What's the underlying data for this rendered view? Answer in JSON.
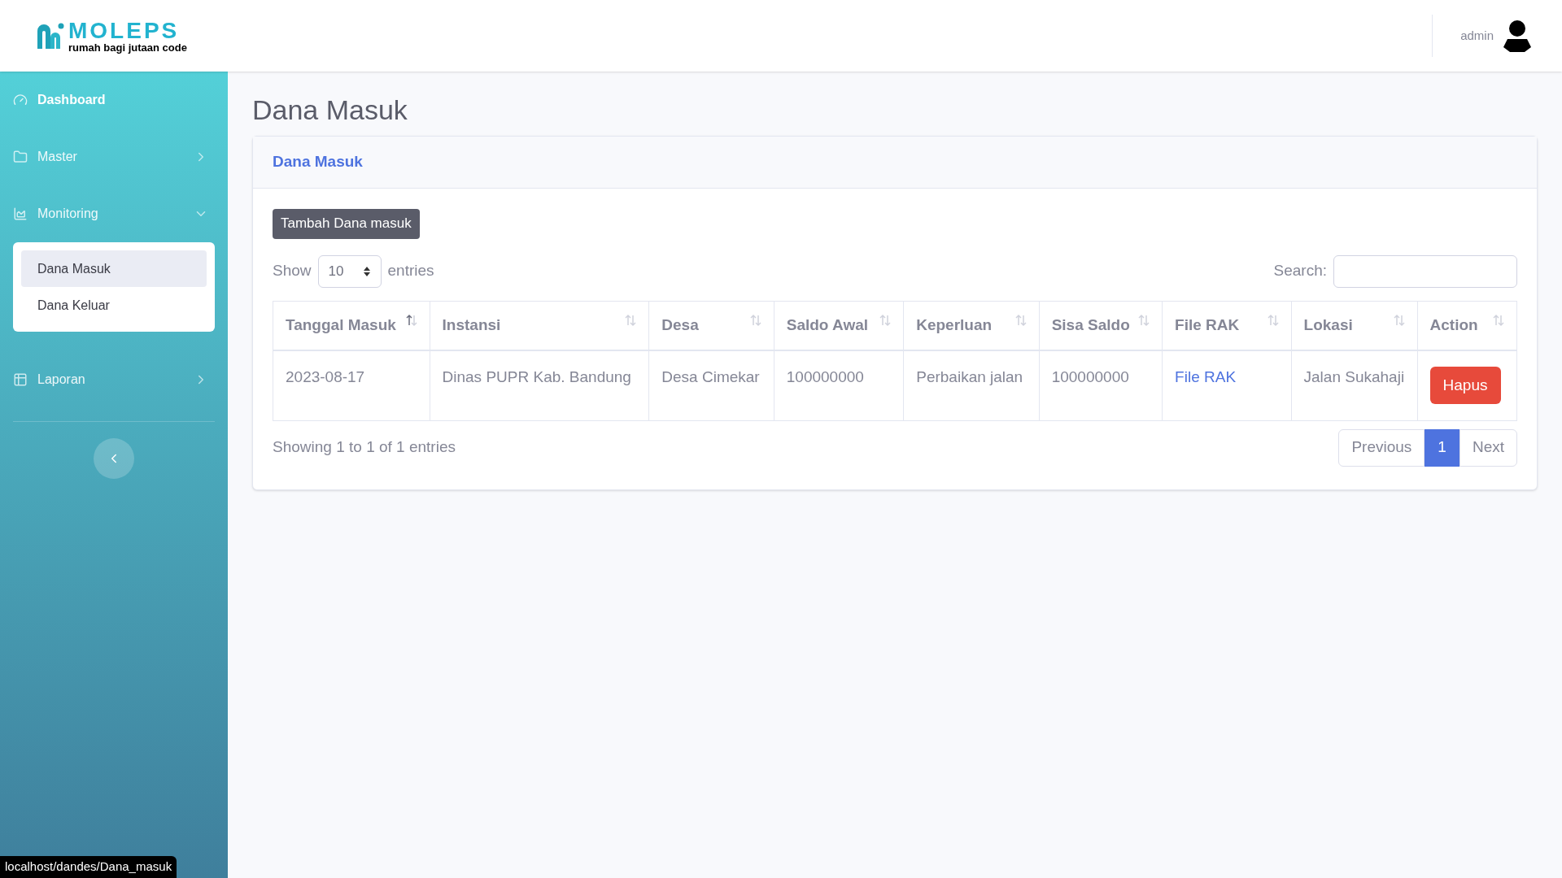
{
  "logo": {
    "name": "MOLEPS",
    "tagline": "rumah bagi jutaan code"
  },
  "user": {
    "name": "admin"
  },
  "sidebar": {
    "items": [
      {
        "kind": "link",
        "label": "Dashboard"
      },
      {
        "kind": "group",
        "label": "Master",
        "expanded": false
      },
      {
        "kind": "group",
        "label": "Monitoring",
        "expanded": true,
        "children": [
          {
            "label": "Dana Masuk",
            "selected": true
          },
          {
            "label": "Dana Keluar",
            "selected": false
          }
        ]
      },
      {
        "kind": "group",
        "label": "Laporan",
        "expanded": false
      }
    ]
  },
  "page_title": "Dana Masuk",
  "card": {
    "title": "Dana Masuk",
    "add_button": "Tambah Dana masuk",
    "length": {
      "before": "Show",
      "value": "10",
      "after": "entries"
    },
    "search": {
      "label": "Search:"
    },
    "table": {
      "columns": [
        {
          "label": "Tanggal Masuk",
          "sorted": true
        },
        {
          "label": "Instansi",
          "sorted": false
        },
        {
          "label": "Desa",
          "sorted": false
        },
        {
          "label": "Saldo Awal",
          "sorted": false
        },
        {
          "label": "Keperluan",
          "sorted": false
        },
        {
          "label": "Sisa Saldo",
          "sorted": false
        },
        {
          "label": "File RAK",
          "sorted": false
        },
        {
          "label": "Lokasi",
          "sorted": false
        },
        {
          "label": "Action",
          "sorted": false
        }
      ],
      "rows": [
        {
          "cells": [
            "2023-08-17",
            "Dinas PUPR Kab. Bandung",
            "Desa Cimekar",
            "100000000",
            "Perbaikan jalan",
            "100000000"
          ],
          "link": "File RAK",
          "lokasi": "Jalan Sukahaji",
          "action": "Hapus"
        }
      ]
    },
    "info": "Showing 1 to 1 of 1 entries",
    "pagination": [
      {
        "label": "Previous",
        "selected": false
      },
      {
        "label": "1",
        "selected": true
      },
      {
        "label": "Next",
        "selected": false
      }
    ]
  },
  "status_url": "localhost/dandes/Dana_masuk"
}
